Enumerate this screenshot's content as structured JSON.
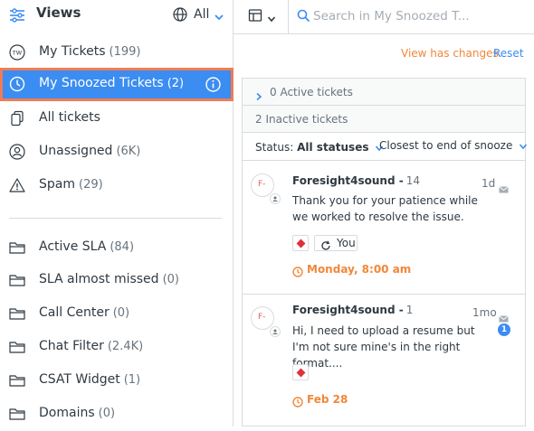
{
  "sidebar": {
    "title": "Views",
    "scope": "All",
    "items": [
      {
        "label": "My Tickets",
        "count": "(199)",
        "icon": "tw-avatar-icon"
      },
      {
        "label": "My Snoozed Tickets",
        "count": "(2)",
        "icon": "clock-icon"
      },
      {
        "label": "All tickets",
        "count": "",
        "icon": "tickets-icon"
      },
      {
        "label": "Unassigned",
        "count": "(6K)",
        "icon": "user-icon"
      },
      {
        "label": "Spam",
        "count": "(29)",
        "icon": "warning-icon"
      },
      {
        "label": "Active SLA",
        "count": "(84)",
        "icon": "folder-icon"
      },
      {
        "label": "SLA almost missed",
        "count": "(0)",
        "icon": "folder-icon"
      },
      {
        "label": "Call Center",
        "count": "(0)",
        "icon": "folder-icon"
      },
      {
        "label": "Chat Filter",
        "count": "(2.4K)",
        "icon": "folder-icon"
      },
      {
        "label": "CSAT Widget",
        "count": "(1)",
        "icon": "folder-icon"
      },
      {
        "label": "Domains",
        "count": "(0)",
        "icon": "folder-icon"
      }
    ],
    "avatar_initials": "TW"
  },
  "topbar": {
    "search_placeholder": "Search in My Snoozed T..."
  },
  "notice": {
    "changes": "View has changes.",
    "reset": "Reset"
  },
  "list": {
    "active_section": "0 Active tickets",
    "inactive_section": "2 Inactive tickets",
    "status_label": "Status:",
    "status_value": "All statuses",
    "sort_label": "Closest to end of snooze",
    "tickets": [
      {
        "initials": "F-",
        "name": "Foresight4sound -",
        "number": "14",
        "time": "1d",
        "body": "Thank you for your patience while we worked to resolve the issue.",
        "assignee_tag": "You",
        "due": "Monday, 8:00 am"
      },
      {
        "initials": "F-",
        "name": "Foresight4sound -",
        "number": "1",
        "time": "1mo",
        "body": "Hi, I need to upload a resume but I'm not sure mine's in the right format....",
        "unread_count": "1",
        "due": "Feb 28"
      }
    ]
  },
  "colors": {
    "accent": "#3b8df1",
    "highlight_outline": "#f07c55",
    "warning_orange": "#f2873a",
    "priority_red": "#e0303c"
  }
}
